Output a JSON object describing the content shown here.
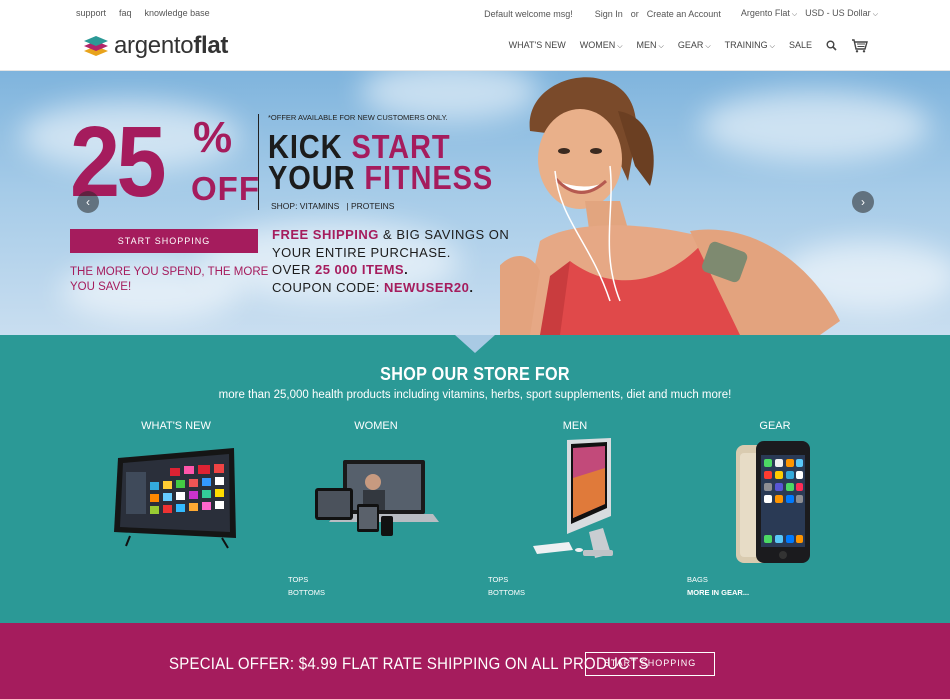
{
  "topbar": {
    "left_links": [
      "support",
      "faq",
      "knowledge base"
    ],
    "welcome": "Default welcome msg!",
    "sign_in": "Sign In",
    "or": "or",
    "create_account": "Create an Account",
    "store": "Argento Flat",
    "currency": "USD - US Dollar"
  },
  "header": {
    "logo_light": "argento",
    "logo_bold": "flat",
    "nav": [
      "WHAT'S NEW",
      "WOMEN",
      "MEN",
      "GEAR",
      "TRAINING",
      "SALE"
    ]
  },
  "hero": {
    "discount": "25",
    "percent": "%",
    "off": "OFF",
    "note": "*OFFER AVAILABLE FOR NEW CUSTOMERS ONLY.",
    "kick": "KICK",
    "start": "START",
    "your": "YOUR",
    "fitness": "FITNESS",
    "shop_line": "SHOP: VITAMINS   | PROTEINS",
    "button": "START SHOPPING",
    "more_spend": "THE MORE YOU SPEND, THE MORE YOU SAVE!",
    "free_shipping": "FREE SHIPPING",
    "line1_rest": " & BIG SAVINGS ON",
    "line2": "YOUR ENTIRE PURCHASE.",
    "line3_a": "OVER ",
    "line3_b": "25 000 ITEMS",
    "line3_c": ".",
    "line4_a": "COUPON CODE: ",
    "line4_b": "NEWUSER20",
    "line4_c": "."
  },
  "shop": {
    "title": "SHOP OUR STORE FOR",
    "subtitle": "more than 25,000 health products including vitamins, herbs, sport supplements, diet and much more!",
    "categories": [
      "WHAT'S NEW",
      "WOMEN",
      "MEN",
      "GEAR"
    ],
    "women_links": [
      "TOPS",
      "BOTTOMS"
    ],
    "men_links": [
      "TOPS",
      "BOTTOMS"
    ],
    "gear_links": [
      "BAGS",
      "MORE IN GEAR..."
    ]
  },
  "bottom": {
    "special": "SPECIAL OFFER: $4.99 FLAT RATE SHIPPING ON ALL PRODUCTS",
    "button": "START SHOPPING"
  },
  "colors": {
    "brand": "#a51c5d",
    "teal": "#2b9996"
  }
}
